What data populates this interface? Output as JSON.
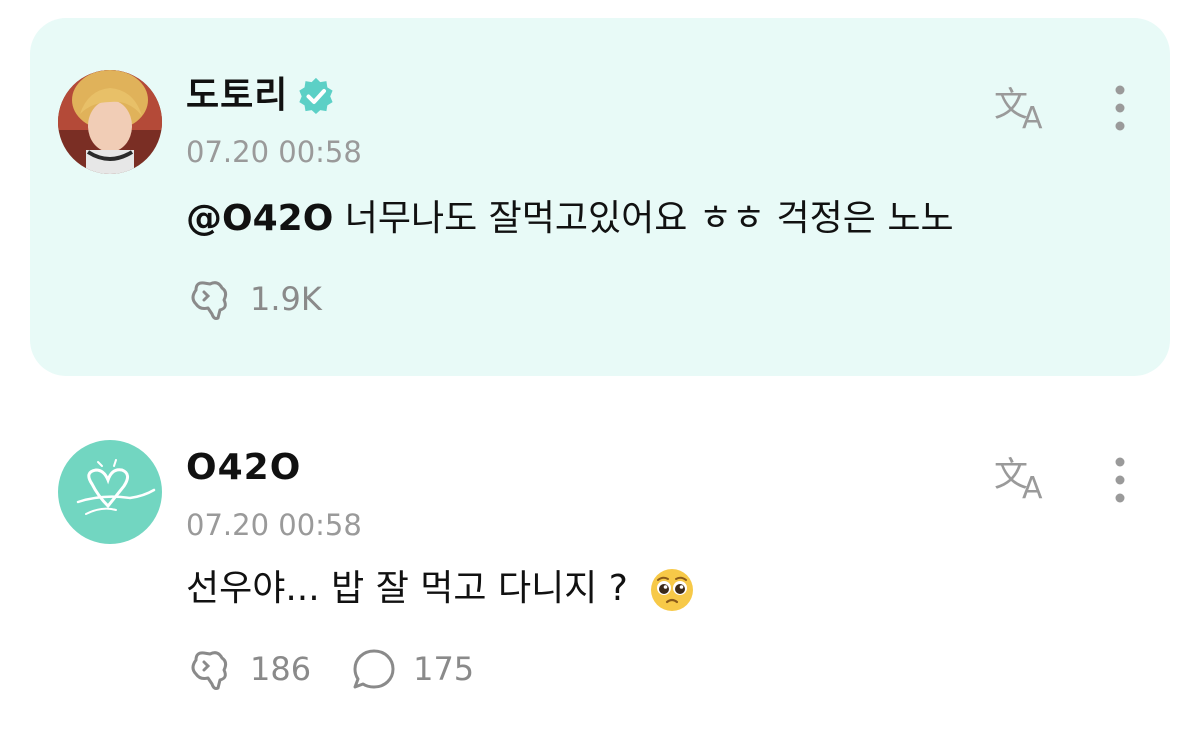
{
  "reply_post": {
    "author": "도토리",
    "verified": true,
    "timestamp": "07.20 00:58",
    "mention": "@O42O",
    "text": " 너무나도 잘먹고있어요 ㅎㅎ 걱정은 노노",
    "likes": "1.9K",
    "icons": {
      "like": "like-icon",
      "translate": "translate-icon",
      "more": "more-vertical-icon",
      "badge": "verified-badge-icon"
    }
  },
  "original_post": {
    "author": "O42O",
    "timestamp": "07.20 00:58",
    "text": "선우야... 밥 잘 먹고 다니지 ?",
    "emoji": "pleading-face-emoji",
    "likes": "186",
    "comments": "175",
    "icons": {
      "like": "like-icon",
      "comment": "comment-icon",
      "translate": "translate-icon",
      "more": "more-vertical-icon"
    }
  },
  "colors": {
    "reply_background": "#e8faf7",
    "verified_badge": "#5cd0c6",
    "muted_text": "#9a9a9a",
    "icon_gray": "#8a8a8a",
    "original_avatar": "#72d6c1"
  }
}
